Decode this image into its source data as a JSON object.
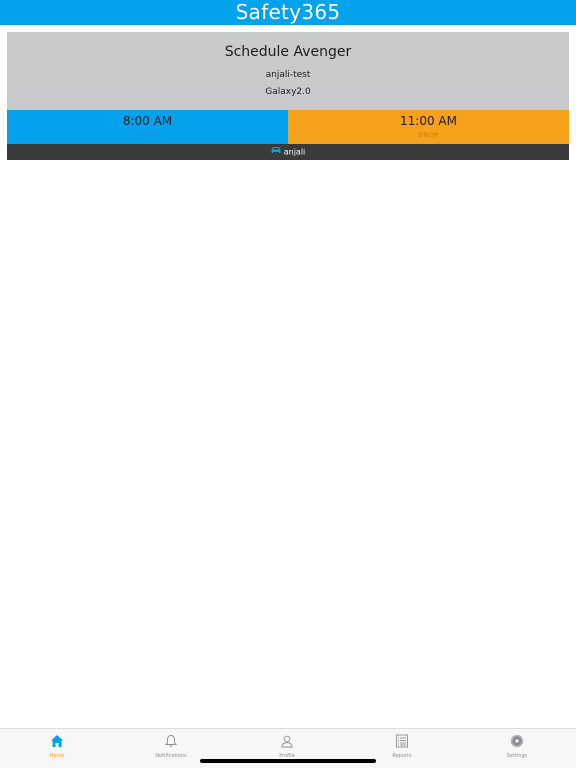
{
  "app": {
    "title": "Safety365"
  },
  "schedule": {
    "name": "Schedule Avenger",
    "account": "anjali-test",
    "vehicle": "Galaxy2.0",
    "pickup": {
      "time": "8:00 AM",
      "label": "PICKUP"
    },
    "drop": {
      "time": "11:00 AM",
      "label": "DROP"
    },
    "driver": "anjali"
  },
  "tabs": [
    {
      "label": "Home",
      "icon": "home-icon",
      "active": true
    },
    {
      "label": "Notifications",
      "icon": "bell-icon",
      "active": false
    },
    {
      "label": "Profile",
      "icon": "person-icon",
      "active": false
    },
    {
      "label": "Reports",
      "icon": "list-icon",
      "active": false
    },
    {
      "label": "Settings",
      "icon": "gear-icon",
      "active": false
    }
  ],
  "colors": {
    "accent_blue": "#03a2ed",
    "accent_orange": "#f5a11c",
    "card_gray": "#c8cacb",
    "driver_bar": "#3a3a3c"
  }
}
